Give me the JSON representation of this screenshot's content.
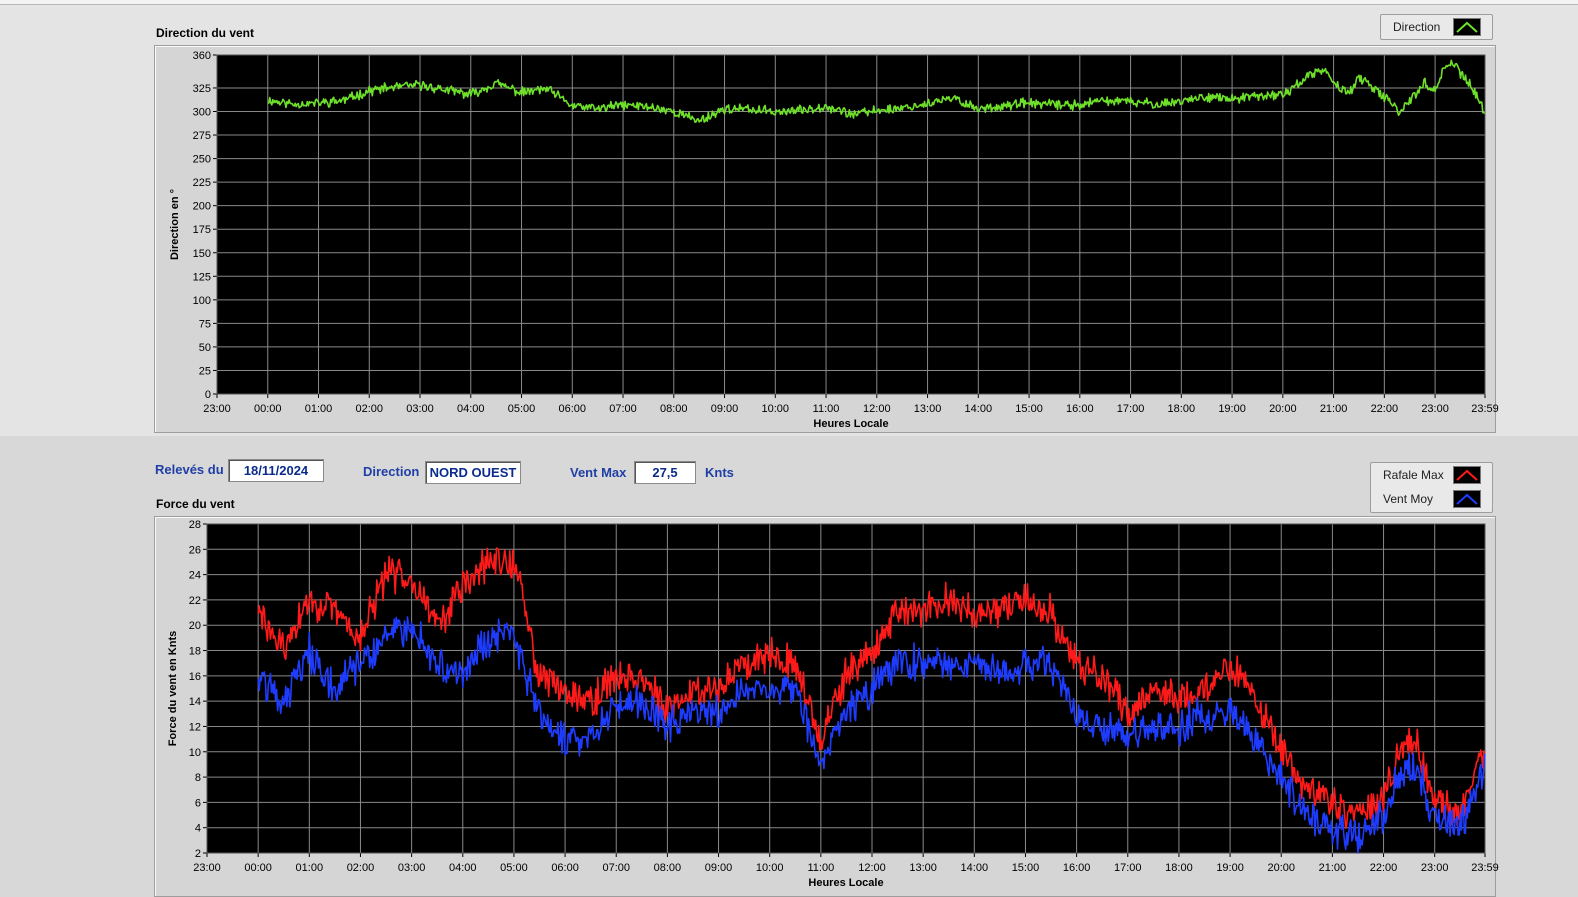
{
  "x_ticks": [
    "23:00",
    "00:00",
    "01:00",
    "02:00",
    "03:00",
    "04:00",
    "05:00",
    "06:00",
    "07:00",
    "08:00",
    "09:00",
    "10:00",
    "11:00",
    "12:00",
    "13:00",
    "14:00",
    "15:00",
    "16:00",
    "17:00",
    "18:00",
    "19:00",
    "20:00",
    "21:00",
    "22:00",
    "23:00",
    "23:59"
  ],
  "info": {
    "releves_label": "Relevés du",
    "releves_value": "18/11/2024",
    "direction_label": "Direction",
    "direction_value": "NORD OUEST",
    "ventmax_label": "Vent Max",
    "ventmax_value": "27,5",
    "unit": "Knts"
  },
  "chart_data": [
    {
      "type": "line",
      "title": "Direction du vent",
      "xlabel": "Heures Locale",
      "ylabel": "Direction en °",
      "ylim": [
        0,
        360
      ],
      "y_ticks": [
        0,
        25,
        50,
        75,
        100,
        125,
        150,
        175,
        200,
        225,
        250,
        275,
        300,
        325,
        360
      ],
      "grid": true,
      "legend_position": "top-right",
      "background": "#000000",
      "x": [
        0,
        0.5,
        1,
        1.5,
        2,
        2.5,
        3,
        3.5,
        4,
        4.5,
        5,
        5.5,
        6,
        6.5,
        7,
        7.5,
        8,
        8.5,
        9,
        9.5,
        10,
        10.5,
        11,
        11.5,
        12,
        12.5,
        13,
        13.5,
        14,
        14.5,
        15,
        15.5,
        16,
        16.5,
        17,
        17.5,
        18,
        18.5,
        19,
        19.5,
        20,
        20.5,
        20.8,
        21,
        21.3,
        21.5,
        22,
        22.3,
        22.5,
        22.8,
        23,
        23.2,
        23.4,
        23.5,
        23.7,
        23.98
      ],
      "series": [
        {
          "name": "Direction",
          "color": "#6ee02a",
          "values": [
            312,
            308,
            309,
            312,
            322,
            326,
            328,
            323,
            318,
            330,
            320,
            324,
            306,
            303,
            307,
            305,
            300,
            290,
            303,
            302,
            300,
            301,
            306,
            297,
            301,
            304,
            308,
            314,
            303,
            306,
            309,
            307,
            307,
            312,
            310,
            308,
            311,
            316,
            313,
            316,
            318,
            337,
            345,
            330,
            320,
            336,
            315,
            300,
            312,
            330,
            322,
            350,
            350,
            340,
            328,
            298
          ]
        }
      ]
    },
    {
      "type": "line",
      "title": "Force du vent",
      "xlabel": "Heures Locale",
      "ylabel": "Force du vent en Knts",
      "ylim": [
        2,
        28
      ],
      "y_ticks": [
        2,
        4,
        6,
        8,
        10,
        12,
        14,
        16,
        18,
        20,
        22,
        24,
        26,
        28
      ],
      "grid": true,
      "legend_position": "top-right",
      "background": "#000000",
      "x": [
        0,
        0.5,
        1,
        1.5,
        2,
        2.5,
        3,
        3.5,
        4,
        4.5,
        5,
        5.5,
        6,
        6.5,
        7,
        7.5,
        8,
        8.5,
        9,
        9.5,
        10,
        10.5,
        11,
        11.5,
        12,
        12.5,
        13,
        13.5,
        14,
        14.5,
        15,
        15.5,
        16,
        16.5,
        17,
        17.5,
        18,
        18.5,
        19,
        19.5,
        20,
        20.5,
        21,
        21.5,
        22,
        22.3,
        22.6,
        23,
        23.5,
        23.98
      ],
      "series": [
        {
          "name": "Rafale Max",
          "color": "#ff1a1a",
          "values": [
            21,
            18,
            22,
            21,
            19,
            24,
            24,
            20,
            23,
            25,
            25,
            16,
            15,
            14,
            16,
            16,
            13,
            15,
            15,
            17,
            18,
            17,
            11,
            16,
            18,
            21,
            21,
            22,
            21,
            21,
            22,
            21,
            17,
            16,
            13,
            15,
            14,
            15,
            17,
            14,
            10,
            7,
            6,
            5,
            6,
            10,
            11,
            6,
            5,
            10
          ]
        },
        {
          "name": "Vent Moy",
          "color": "#1e3cff",
          "values": [
            16,
            14,
            18,
            15,
            17,
            19,
            20,
            17,
            16,
            19,
            19,
            13,
            11,
            11,
            14,
            14,
            12,
            13,
            13,
            15,
            15,
            15,
            9,
            13,
            15,
            17,
            17,
            17,
            17,
            16,
            17,
            17,
            13,
            12,
            11,
            12,
            12,
            13,
            13,
            11,
            8,
            5,
            4,
            3,
            5,
            8,
            9,
            5,
            4,
            9
          ]
        }
      ]
    }
  ]
}
